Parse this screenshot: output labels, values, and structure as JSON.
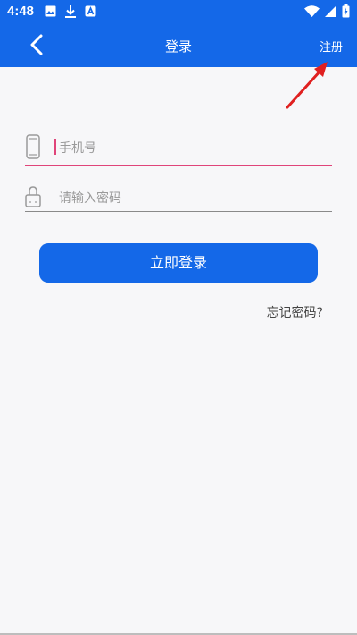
{
  "status_bar": {
    "time": "4:48",
    "left_icons": [
      "image-icon",
      "download-icon",
      "app-notification-icon"
    ],
    "right_icons": [
      "wifi-icon",
      "signal-icon",
      "battery-icon"
    ]
  },
  "app_bar": {
    "title": "登录",
    "back_icon": "chevron-left-icon",
    "register_label": "注册"
  },
  "login_form": {
    "phone_placeholder": "手机号",
    "phone_value": "",
    "phone_icon": "phone-icon",
    "password_placeholder": "请输入密码",
    "password_value": "",
    "password_icon": "lock-icon",
    "submit_label": "立即登录",
    "forgot_label": "忘记密码?"
  },
  "colors": {
    "primary": "#1468e8",
    "focus_underline": "#e0457a",
    "annotation_arrow": "#e02020"
  }
}
